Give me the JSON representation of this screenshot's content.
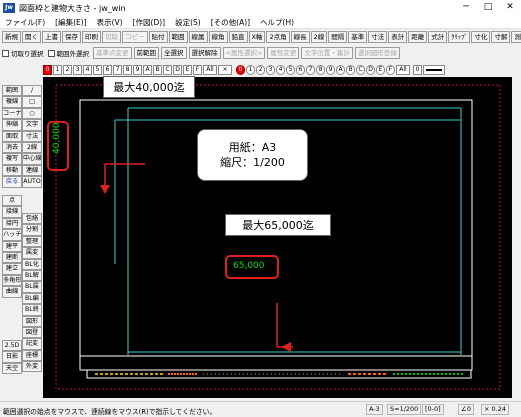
{
  "window": {
    "title": "図面枠と建物大きさ - jw_win",
    "app_icon": "Jw",
    "controls": [
      "─",
      "□",
      "✕"
    ]
  },
  "menu": [
    "ファイル(F)",
    "[編集(E)]",
    "表示(V)",
    "[作図(D)]",
    "設定(S)",
    "[その他(A)]",
    "ヘルプ(H)"
  ],
  "toolbar1_left": [
    "新規",
    "開く",
    "上書",
    "保存",
    "印刷",
    "切取",
    "コピー",
    "貼付",
    "範囲",
    "線属",
    "線角",
    "鉛直",
    "X軸",
    "2点角",
    "線長",
    "2線",
    "間隔",
    "基準"
  ],
  "toolbar1_left_disabled": [
    5,
    6
  ],
  "toolbar1_right": [
    "寸法",
    "表計",
    "距離",
    "式計",
    "ｸﾘｯﾌﾟ",
    "寸化",
    "寸解",
    "測定"
  ],
  "toolbar2": {
    "checks": [
      "切取り選択",
      "範囲外選択"
    ],
    "buttons": [
      "基準点変更",
      "前範囲",
      "全選択",
      "選択解除",
      "<属性選択>",
      "属性変更",
      "文字位置・集計",
      "選択図形登録"
    ],
    "disabled": [
      0,
      4,
      5,
      6,
      7
    ]
  },
  "layer_groups": {
    "current": "0",
    "labels": [
      "0",
      "1",
      "2",
      "3",
      "4",
      "5",
      "6",
      "7",
      "8",
      "9",
      "A",
      "B",
      "C",
      "D",
      "E",
      "F"
    ],
    "all_label": "All",
    "x_label": "×"
  },
  "layers": {
    "current": "0",
    "labels": [
      "0",
      "1",
      "2",
      "3",
      "4",
      "5",
      "6",
      "7",
      "8",
      "9",
      "A",
      "B",
      "C",
      "D",
      "E",
      "F"
    ],
    "all_label": "All"
  },
  "palette_left": [
    "/",
    "□",
    "○",
    "文字",
    "寸法",
    "2線",
    "中心線",
    "連線",
    "AUTO",
    "",
    "範囲",
    "複線",
    "コーナー",
    "伸縮",
    "面取",
    "消去",
    "複写",
    "移動",
    "戻る"
  ],
  "palette_left_top": [
    "範囲",
    "線",
    "矩形",
    "円弧",
    "文字",
    "寸法",
    "2線",
    "中心線",
    "連線",
    "AUTO"
  ],
  "palette_col_a": [
    "範囲",
    "複線",
    "コーナー",
    "伸縮",
    "面取",
    "消去",
    "複写",
    "移動",
    "戻る"
  ],
  "palette_col_b": [
    "/",
    "□",
    "○",
    "文字",
    "寸法",
    "2線",
    "中心線",
    "連線",
    "AUTO"
  ],
  "palette_col_a2": [
    "点",
    "接線",
    "接円",
    "ハッチ",
    "建平",
    "建断",
    "建立",
    "多角形",
    "曲線"
  ],
  "palette_col_b2": [
    "包絡",
    "分割",
    "整理",
    "属変",
    "BL化",
    "BL解",
    "BL属",
    "BL編",
    "BL終",
    "図形",
    "図登",
    "記変",
    "座標",
    "外変"
  ],
  "palette_bottom_a": [
    "2.5D",
    "日影",
    "天空"
  ],
  "annotations": {
    "max40_label": "最大40,000迄",
    "max65_label": "最大65,000迄",
    "paper_line1": "用紙：A3",
    "paper_line2": "縮尺：1/200",
    "dim_vertical": "40,000",
    "dim_horizontal": "65,000"
  },
  "colors": {
    "canvas_bg": "#000000",
    "frame_white": "#ffffff",
    "frame_cyan": "#40d0d0",
    "dim_green": "#00e000",
    "callout_red": "#e02020",
    "dotted_magenta": "#c01060"
  },
  "statusbar": {
    "message": "範囲選択の始点をマウスで、連続線をマウス(R)で指示してください。",
    "paper": "A-3",
    "scale": "S=1/200",
    "layer": "[0-0]",
    "angle": "∠0",
    "zoom": "× 0.24"
  }
}
